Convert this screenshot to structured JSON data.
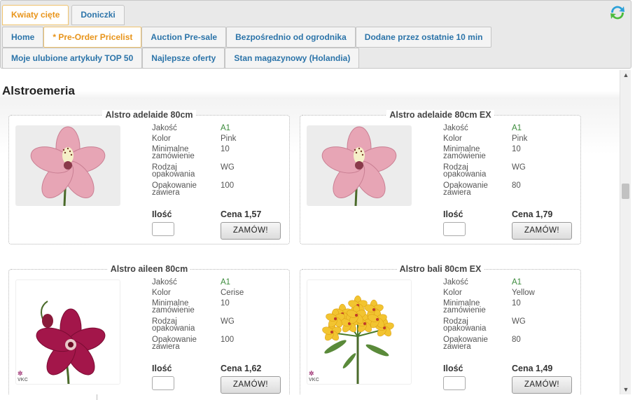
{
  "category_tabs": [
    "Kwiaty cięte",
    "Doniczki"
  ],
  "nav_row1": [
    "Home",
    "* Pre-Order Pricelist",
    "Auction Pre-sale",
    "Bezpośrednio od ogrodnika",
    "Dodane przez ostatnie 10 min"
  ],
  "nav_row2": [
    "Moje ulubione artykuły TOP 50",
    "Najlepsze oferty",
    "Stan magazynowy (Holandia)"
  ],
  "section_title": "Alstroemeria",
  "labels": {
    "quality": "Jakość",
    "color": "Kolor",
    "min_order": "Minimalne zamówienie",
    "pack_type": "Rodzaj opakowania",
    "pack_contains": "Opakowanie zawiera",
    "quantity": "Ilość",
    "order_button": "ZAMÓW!"
  },
  "products": [
    {
      "title": "Alstro adelaide 80cm",
      "quality": "A1",
      "color": "Pink",
      "min_order": "10",
      "pack_type": "WG",
      "pack_contains": "100",
      "price": "Cena 1,57",
      "flower": "pink"
    },
    {
      "title": "Alstro adelaide 80cm EX",
      "quality": "A1",
      "color": "Pink",
      "min_order": "10",
      "pack_type": "WG",
      "pack_contains": "80",
      "price": "Cena 1,79",
      "flower": "pink"
    },
    {
      "title": "Alstro aileen 80cm",
      "quality": "A1",
      "color": "Cerise",
      "min_order": "10",
      "pack_type": "WG",
      "pack_contains": "100",
      "price": "Cena 1,62",
      "flower": "cerise",
      "watermark": "VKC"
    },
    {
      "title": "Alstro bali 80cm EX",
      "quality": "A1",
      "color": "Yellow",
      "min_order": "10",
      "pack_type": "WG",
      "pack_contains": "80",
      "price": "Cena 1,49",
      "flower": "yellow",
      "watermark": "VKC"
    }
  ],
  "colors": {
    "active_tab": "#e8941a",
    "tab_text": "#2c74a9",
    "quality_green": "#3a8a3a"
  }
}
